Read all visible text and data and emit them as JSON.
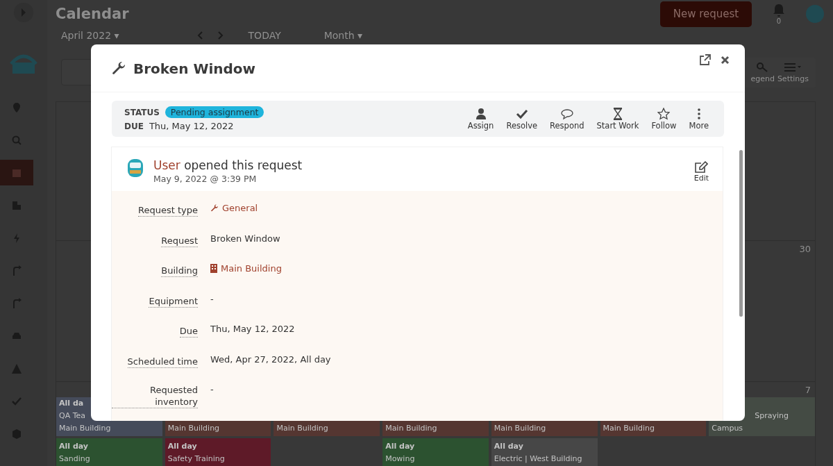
{
  "sidebar": {
    "items": [
      {
        "kind": "pin",
        "selected": false
      },
      {
        "kind": "search",
        "selected": false
      },
      {
        "kind": "calendar",
        "selected": true
      },
      {
        "kind": "buildings",
        "selected": false
      },
      {
        "kind": "bolt",
        "selected": false
      },
      {
        "kind": "route",
        "selected": false
      },
      {
        "kind": "route",
        "selected": false
      },
      {
        "kind": "car",
        "selected": false
      },
      {
        "kind": "warning",
        "selected": false
      },
      {
        "kind": "check",
        "selected": false
      },
      {
        "kind": "box",
        "selected": false
      }
    ]
  },
  "header": {
    "title": "Calendar",
    "new_request": "New request",
    "notification_count": "0"
  },
  "toolbar": {
    "month": "April 2022 ▾",
    "today": "TODAY",
    "view": "Month ▾",
    "legend": "egend",
    "settings": "Settings"
  },
  "calendar": {
    "day_numbers": [
      "30",
      "7"
    ],
    "week": [
      {
        "events": [
          {
            "color": "#454b5a",
            "lines": [
              {
                "kind": "allday",
                "text": "All da"
              },
              {
                "kind": "title",
                "text": "QA Tea"
              },
              {
                "kind": "title",
                "text": "Main Building"
              }
            ]
          },
          {
            "color": "#2c5230",
            "lines": [
              {
                "kind": "allday",
                "text": "All day"
              },
              {
                "kind": "title",
                "text": "Sanding"
              }
            ]
          }
        ]
      },
      {
        "events": [
          {
            "color": "#553631",
            "lines": [
              {
                "kind": "title",
                "text": "Main Building"
              }
            ]
          },
          {
            "color": "#5e1a28",
            "lines": [
              {
                "kind": "allday",
                "text": "All day"
              },
              {
                "kind": "title",
                "text": "Safety Training"
              }
            ]
          }
        ]
      },
      {
        "events": [
          {
            "color": "#553631",
            "lines": [
              {
                "kind": "title",
                "text": "Main Building"
              }
            ]
          }
        ]
      },
      {
        "events": [
          {
            "color": "#553631",
            "lines": [
              {
                "kind": "title",
                "text": "Main Building"
              }
            ]
          },
          {
            "color": "#2c5230",
            "lines": [
              {
                "kind": "allday",
                "text": "All day"
              },
              {
                "kind": "title",
                "text": "Mowing"
              }
            ]
          }
        ]
      },
      {
        "events": [
          {
            "color": "#553631",
            "lines": [
              {
                "kind": "title",
                "text": "Main Building"
              }
            ]
          },
          {
            "color": "#474747",
            "lines": [
              {
                "kind": "allday",
                "text": "All day"
              },
              {
                "kind": "title",
                "text": "Electric | West Building"
              }
            ]
          }
        ]
      },
      {
        "events": [
          {
            "color": "#553631",
            "lines": [
              {
                "kind": "title",
                "text": "Main Building"
              }
            ]
          }
        ]
      },
      {
        "events": [
          {
            "color": "#444b44",
            "lines": [
              {
                "kind": "partial",
                "text": "Spraying"
              },
              {
                "kind": "title",
                "text": "Campus"
              }
            ]
          }
        ]
      }
    ]
  },
  "modal": {
    "title": "Broken Window",
    "status_label": "STATUS",
    "status": "Pending assignment",
    "due_label": "DUE",
    "due": "Thu, May 12, 2022",
    "actions": [
      {
        "kind": "person",
        "label": "Assign"
      },
      {
        "kind": "check",
        "label": "Resolve"
      },
      {
        "kind": "bubble",
        "label": "Respond"
      },
      {
        "kind": "hourglass",
        "label": "Start Work"
      },
      {
        "kind": "star",
        "label": "Follow"
      },
      {
        "kind": "dots",
        "label": "More"
      }
    ],
    "activity": {
      "user": "User",
      "text": "opened this request",
      "time": "May 9, 2022 @ 3:39 PM",
      "edit": "Edit"
    },
    "fields": [
      {
        "label": "Request type",
        "value": "General",
        "kind": "link-wrench"
      },
      {
        "label": "Request",
        "value": "Broken Window",
        "kind": "plain"
      },
      {
        "label": "Building",
        "value": "Main Building",
        "kind": "link-building"
      },
      {
        "label": "Equipment",
        "value": "-",
        "kind": "plain"
      },
      {
        "label": "Due",
        "value": "Thu, May 12, 2022",
        "kind": "plain"
      },
      {
        "label": "Scheduled time",
        "value": "Wed, Apr 27, 2022, All day",
        "kind": "plain"
      },
      {
        "label": "Requested inventory",
        "value": "-",
        "kind": "plain"
      }
    ]
  }
}
